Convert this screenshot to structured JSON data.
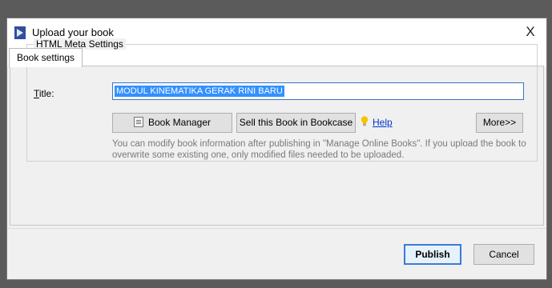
{
  "window": {
    "title": "Upload your book",
    "close_label": "X"
  },
  "tabs": [
    {
      "label": "Book settings",
      "active": true
    }
  ],
  "meta_settings": {
    "group_label": "HTML Meta Settings",
    "title_label_accel": "T",
    "title_label_rest": "itle:",
    "title_value": "MODUL KINEMATIKA GERAK RINI BARU"
  },
  "actions": {
    "book_manager_label": "Book Manager",
    "sell_label": "Sell this Book in Bookcase",
    "help_label": "Help",
    "more_label": "More>>"
  },
  "info_text": "You can modify book information after publishing in \"Manage Online Books\". If you upload the book to overwrite some existing one, only modified files needed to be uploaded.",
  "footer": {
    "publish_label": "Publish",
    "cancel_label": "Cancel"
  },
  "colors": {
    "selection": "#3390ff",
    "focus_border": "#3a7bd5",
    "link": "#0033cc",
    "help_bulb": "#f5c400"
  },
  "icons": {
    "app": "book-upload-icon",
    "book_manager": "book-manager-icon",
    "help": "lightbulb-icon"
  }
}
